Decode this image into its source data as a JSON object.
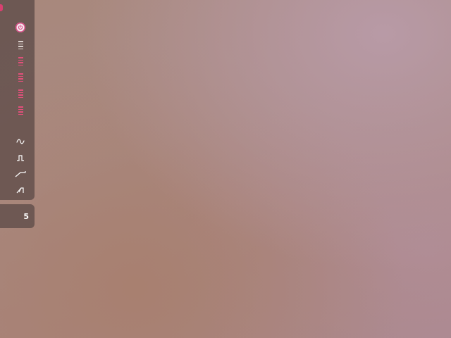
{
  "toolbar": {
    "buttons": [
      {
        "icon": "power-icon",
        "color": "#d94a84"
      },
      {
        "icon": "menu-lines-icon",
        "color": "#d9d0cc"
      },
      {
        "icon": "menu-lines-icon",
        "color": "#e0507a"
      },
      {
        "icon": "menu-lines-icon",
        "color": "#e0507a"
      },
      {
        "icon": "menu-lines-icon",
        "color": "#e0507a"
      },
      {
        "icon": "menu-lines-icon",
        "color": "#e0507a"
      },
      {
        "icon": "sine-wave-icon",
        "color": "#ffffff"
      },
      {
        "icon": "square-wave-icon",
        "color": "#ffffff"
      },
      {
        "icon": "ramp-wave-icon",
        "color": "#ffffff"
      },
      {
        "icon": "sawtooth-wave-icon",
        "color": "#ffffff"
      }
    ]
  },
  "counter": {
    "value": "5"
  },
  "colors": {
    "accent": "#e0507a",
    "panel": "#604e4a"
  }
}
